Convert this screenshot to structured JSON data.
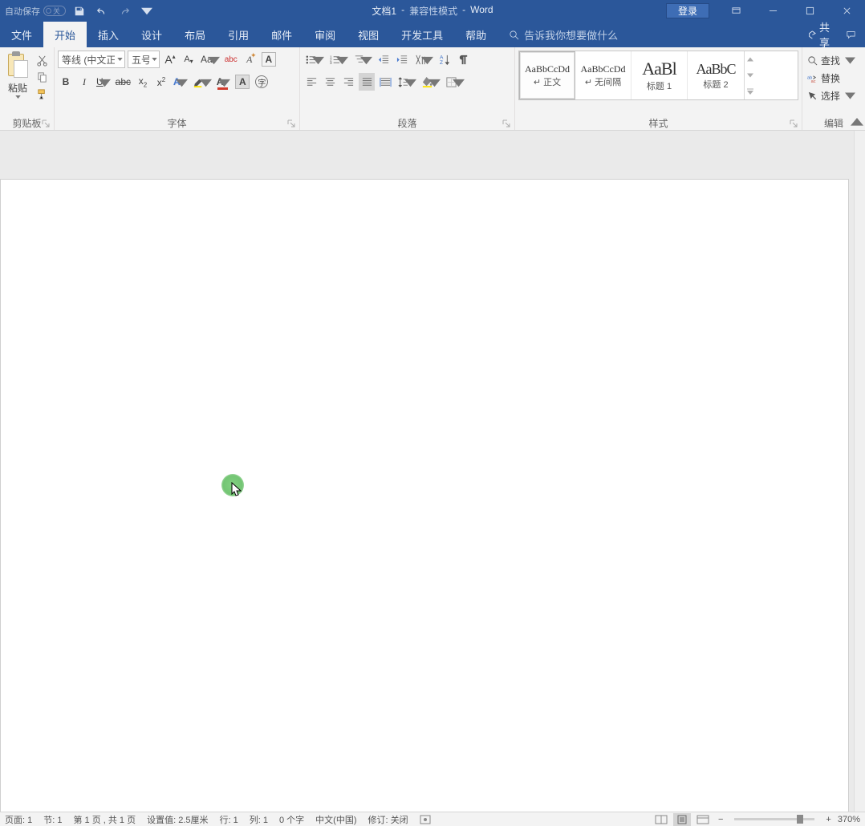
{
  "title": {
    "autosave": "自动保存",
    "autosave_state": "关",
    "doc": "文档1",
    "mode": "兼容性模式",
    "app": "Word",
    "login": "登录"
  },
  "tabs": {
    "file": "文件",
    "home": "开始",
    "insert": "插入",
    "design": "设计",
    "layout": "布局",
    "references": "引用",
    "mailings": "邮件",
    "review": "审阅",
    "view": "视图",
    "developer": "开发工具",
    "help": "帮助",
    "tellme": "告诉我你想要做什么",
    "share": "共享"
  },
  "clip": {
    "paste": "粘贴",
    "group": "剪贴板"
  },
  "font": {
    "name": "等线 (中文正",
    "size": "五号",
    "group": "字体"
  },
  "para": {
    "group": "段落"
  },
  "styles": {
    "group": "样式",
    "items": [
      {
        "preview": "AaBbCcDd",
        "label": "↵ 正文",
        "size": "sm"
      },
      {
        "preview": "AaBbCcDd",
        "label": "↵ 无间隔",
        "size": "sm"
      },
      {
        "preview": "AaBl",
        "label": "标题 1",
        "size": "big"
      },
      {
        "preview": "AaBbC",
        "label": "标题 2",
        "size": "big"
      }
    ]
  },
  "edit": {
    "find": "查找",
    "replace": "替换",
    "select": "选择",
    "group": "编辑"
  },
  "status": {
    "page": "页面: 1",
    "section": "节: 1",
    "pages": "第 1 页 , 共 1 页",
    "setting": "设置值: 2.5厘米",
    "line": "行: 1",
    "col": "列: 1",
    "words": "0 个字",
    "lang": "中文(中国)",
    "track": "修订: 关闭",
    "zoom": "370%"
  }
}
